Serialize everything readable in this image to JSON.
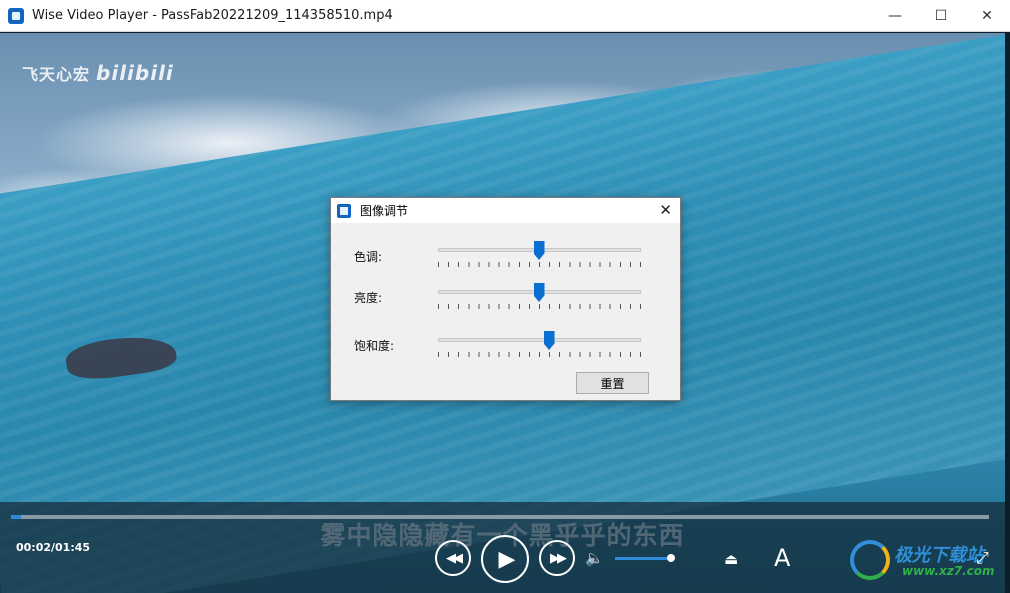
{
  "window": {
    "title": "Wise Video Player - PassFab20221209_114358510.mp4",
    "icon": "app-logo-icon",
    "controls": [
      "minimize-icon",
      "maximize-icon",
      "close-icon"
    ]
  },
  "video": {
    "watermark": "飞天心宏",
    "watermark_brand": "bilibili",
    "subtitle": "雾中隐隐藏有一个黑乎乎的东西"
  },
  "player": {
    "time": "00:02/01:45",
    "progress_fraction": 0.01,
    "volume_fraction": 1.0,
    "subtitle_button": "A",
    "accent_color": "#2e8ad8"
  },
  "dialog": {
    "title": "图像调节",
    "sliders": [
      {
        "label": "色调:",
        "value_fraction": 0.5
      },
      {
        "label": "亮度:",
        "value_fraction": 0.5
      },
      {
        "label": "饱和度:",
        "value_fraction": 0.55
      }
    ],
    "reset_label": "重置"
  },
  "site_logo": {
    "name": "极光下载站",
    "url": "www.xz7.com"
  }
}
